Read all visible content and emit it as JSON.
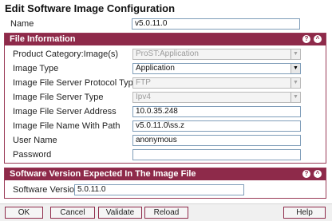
{
  "page": {
    "title": "Edit Software Image Configuration"
  },
  "name_field": {
    "label": "Name",
    "value": "v5.0.11.0"
  },
  "file_info": {
    "header": "File Information",
    "help_icon": "?",
    "collapse_icon": "^",
    "fields": {
      "product_category": {
        "label": "Product Category:Image(s)",
        "value": "ProST:Application"
      },
      "image_type": {
        "label": "Image Type",
        "value": "Application"
      },
      "protocol_type": {
        "label": "Image File Server Protocol Type",
        "value": "FTP"
      },
      "server_type": {
        "label": "Image File Server Type",
        "value": "Ipv4"
      },
      "server_address": {
        "label": "Image File Server Address",
        "value": "10.0.35.248"
      },
      "file_name": {
        "label": "Image File Name With Path",
        "value": "v5.0.11.0\\ss.z"
      },
      "user_name": {
        "label": "User Name",
        "value": "anonymous"
      },
      "password": {
        "label": "Password",
        "value": ""
      }
    }
  },
  "version_section": {
    "header": "Software Version Expected In The Image File",
    "help_icon": "?",
    "collapse_icon": "^",
    "field": {
      "label": "Software Version",
      "value": "5.0.11.0"
    }
  },
  "buttons": {
    "ok": "OK",
    "cancel": "Cancel",
    "validate": "Validate",
    "reload": "Reload",
    "help": "Help"
  },
  "colors": {
    "section_header": "#8e2a4a",
    "input_border": "#7f9db9",
    "button_border": "#8e2a4a"
  }
}
